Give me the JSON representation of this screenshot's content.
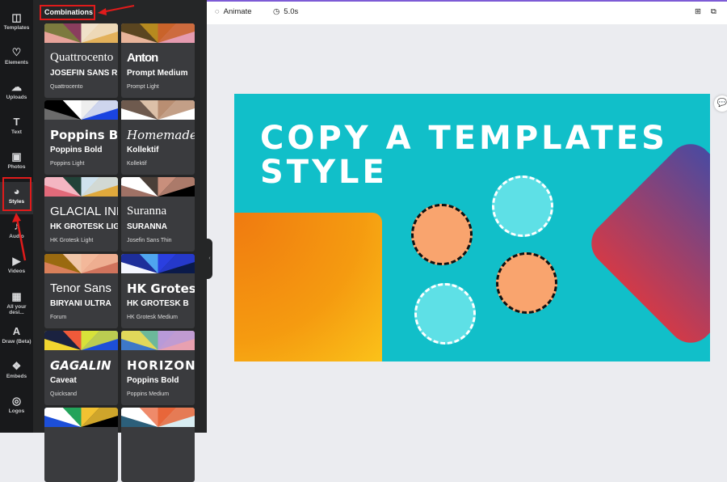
{
  "rail": [
    {
      "label": "Templates",
      "icon": "templates-icon",
      "glyph": "◫"
    },
    {
      "label": "Elements",
      "icon": "elements-icon",
      "glyph": "♡"
    },
    {
      "label": "Uploads",
      "icon": "upload-cloud-icon",
      "glyph": "☁"
    },
    {
      "label": "Text",
      "icon": "text-icon",
      "glyph": "T"
    },
    {
      "label": "Photos",
      "icon": "photos-icon",
      "glyph": "▣"
    },
    {
      "label": "Styles",
      "icon": "palette-icon",
      "glyph": "◕"
    },
    {
      "label": "Audio",
      "icon": "audio-icon",
      "glyph": "♪"
    },
    {
      "label": "Videos",
      "icon": "videos-icon",
      "glyph": "▶"
    },
    {
      "label": "All your desi...",
      "icon": "designs-grid-icon",
      "glyph": "▦"
    },
    {
      "label": "Draw (Beta)",
      "icon": "draw-icon",
      "glyph": "A"
    },
    {
      "label": "Embeds",
      "icon": "embeds-icon",
      "glyph": "❖"
    },
    {
      "label": "Logos",
      "icon": "logos-icon",
      "glyph": "◎"
    }
  ],
  "panel": {
    "title": "Combinations",
    "cards": [
      {
        "f1": "Quattrocento",
        "f2": "JOSEFIN SANS R",
        "f3": "Quattrocento",
        "colors": [
          "#e7a39a",
          "#7c7a3e",
          "#8a3d5e",
          "#f0e1c9",
          "#e3b15a"
        ]
      },
      {
        "f1": "Anton",
        "f2": "Prompt Medium",
        "f3": "Prompt Light",
        "colors": [
          "#e8b49a",
          "#5a4520",
          "#b68a1f",
          "#c9632a",
          "#e59bb0"
        ]
      },
      {
        "f1": "Poppins Bold",
        "f2": "Poppins Bold",
        "f3": "Poppins Light",
        "colors": [
          "#6b6b6b",
          "#000000",
          "#ffffff",
          "#eeeeee",
          "#1a44e0"
        ]
      },
      {
        "f1": "Homemade",
        "f2": "Kollektif",
        "f3": "Kollektif",
        "colors": [
          "#ffffff",
          "#6e5a4e",
          "#dcc0a8",
          "#b98e72",
          "#ffffff"
        ]
      },
      {
        "f1": "GLACIAL INDIFFERENCE",
        "f2": "HK GROTESK LIGHT",
        "f3": "HK Grotesk Light",
        "colors": [
          "#e26a7a",
          "#f4b6c2",
          "#214238",
          "#cfe2ee",
          "#e0a93c"
        ]
      },
      {
        "f1": "Suranna",
        "f2": "SURANNA",
        "f3": "Josefin Sans Thin",
        "colors": [
          "#a07266",
          "#ffffff",
          "#4a3f38",
          "#c98f7c",
          "#000000"
        ]
      },
      {
        "f1": "Tenor Sans",
        "f2": "BIRYANI ULTRA",
        "f3": "Forum",
        "colors": [
          "#d9805a",
          "#9a6a10",
          "#f0c6a8",
          "#f3b89a",
          "#d0735c"
        ]
      },
      {
        "f1": "HK Grotesk",
        "f2": "HK GROTESK B",
        "f3": "HK Grotesk Medium",
        "colors": [
          "#f4f6ff",
          "#1d2e9a",
          "#4fa6ef",
          "#2a3fe0",
          "#0a1a4a"
        ]
      },
      {
        "f1": "GAGALIN",
        "f2": "Caveat",
        "f3": "Quicksand",
        "colors": [
          "#f1d530",
          "#1a2240",
          "#ef5a3a",
          "#d7e23a",
          "#1d4fd8"
        ]
      },
      {
        "f1": "HORIZON",
        "f2": "Poppins Bold",
        "f3": "Poppins Medium",
        "colors": [
          "#3d78c8",
          "#e1d85a",
          "#6cb89a",
          "#b89ad8",
          "#e8a0b0"
        ]
      },
      {
        "f1": "",
        "f2": "",
        "f3": "",
        "colors": [
          "#1d4fd8",
          "#ffffff",
          "#23a35a",
          "#f3c232",
          "#000000"
        ]
      },
      {
        "f1": "",
        "f2": "",
        "f3": "",
        "colors": [
          "#2c5f7a",
          "#ffffff",
          "#ef8a6a",
          "#e8663a",
          "#d8edf2"
        ]
      }
    ]
  },
  "topbar": {
    "animate": "Animate",
    "duration": "5.0s"
  },
  "design": {
    "title": "COPY A TEMPLATES STYLE",
    "background": "#11bfc9"
  }
}
